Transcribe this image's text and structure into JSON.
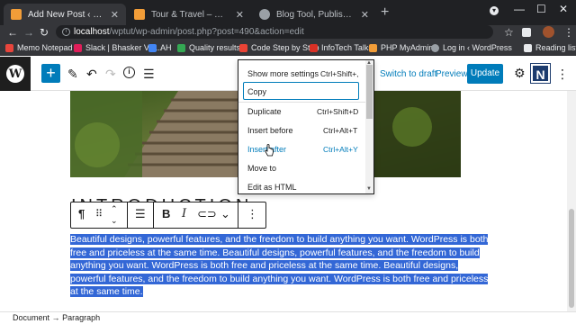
{
  "browser": {
    "tabs": [
      {
        "title": "Add New Post ‹ WPTUT — WordPress",
        "favicon_color": "#f29d38",
        "active": true
      },
      {
        "title": "Tour & Travel – WPTUT",
        "favicon_color": "#f29d38",
        "active": false
      },
      {
        "title": "Blog Tool, Publishing Platform, and CMS",
        "favicon_color": "#9aa0a6",
        "active": false
      }
    ],
    "url_host": "localhost",
    "url_path": "/wptut/wp-admin/post.php?post=490&action=edit",
    "bookmarks": [
      {
        "label": "Memo Notepad",
        "color": "#e8453c"
      },
      {
        "label": "Slack | Bhasker Ver...",
        "color": "#e01e5a"
      },
      {
        "label": "AH",
        "color": "#4285f4"
      },
      {
        "label": "Quality results",
        "color": "#34a853"
      },
      {
        "label": "Code Step by Step",
        "color": "#ea4335"
      },
      {
        "label": "InfoTech Talks",
        "color": "#d93025"
      },
      {
        "label": "PHP MyAdmin",
        "color": "#f29d38"
      },
      {
        "label": "Log in ‹ WordPress",
        "color": "#9aa0a6"
      }
    ],
    "reading_list": "Reading list"
  },
  "editor": {
    "switch_to_draft": "Switch to draft",
    "preview": "Preview",
    "update": "Update",
    "n_logo": "N",
    "heading_text": "INTRODUCTION",
    "paragraph": "Beautiful designs, powerful features, and the freedom to build anything you want. WordPress is both free and priceless at the same time. Beautiful designs, powerful features, and the freedom to build anything you want. WordPress is both free and priceless at the same time. Beautiful designs, powerful features, and the freedom to build anything you want. WordPress is both free and priceless at the same time.",
    "breadcrumb_document": "Document",
    "breadcrumb_sep": "→",
    "breadcrumb_paragraph": "Paragraph",
    "accent_color": "#007cba",
    "selection_color": "#3367d6"
  },
  "menu": {
    "items": [
      {
        "label": "Show more settings",
        "shortcut": "Ctrl+Shift+,"
      },
      {
        "label": "Copy",
        "shortcut": ""
      },
      {
        "label": "Duplicate",
        "shortcut": "Ctrl+Shift+D"
      },
      {
        "label": "Insert before",
        "shortcut": "Ctrl+Alt+T"
      },
      {
        "label": "Insert after",
        "shortcut": "Ctrl+Alt+Y"
      },
      {
        "label": "Move to",
        "shortcut": ""
      },
      {
        "label": "Edit as HTML",
        "shortcut": ""
      }
    ]
  }
}
